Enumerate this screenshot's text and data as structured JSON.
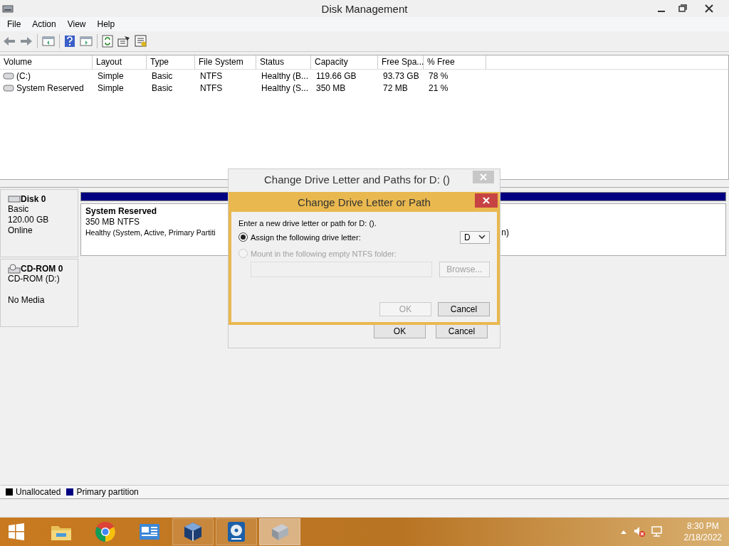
{
  "window": {
    "title": "Disk Management"
  },
  "menu": [
    "File",
    "Action",
    "View",
    "Help"
  ],
  "table": {
    "columns": [
      "Volume",
      "Layout",
      "Type",
      "File System",
      "Status",
      "Capacity",
      "Free Spa...",
      "% Free"
    ],
    "rows": [
      [
        "(C:)",
        "Simple",
        "Basic",
        "NTFS",
        "Healthy (B...",
        "119.66 GB",
        "93.73 GB",
        "78 %"
      ],
      [
        "System Reserved",
        "Simple",
        "Basic",
        "NTFS",
        "Healthy (S...",
        "350 MB",
        "72 MB",
        "21 %"
      ]
    ]
  },
  "disks": [
    {
      "kind": "disk",
      "name": "Disk 0",
      "lines": [
        "Basic",
        "120.00 GB",
        "Online"
      ],
      "partition": {
        "name": "System Reserved",
        "size": "350 MB NTFS",
        "status_start": "Healthy (System, Active, Primary Partiti",
        "status_end": "n)"
      }
    },
    {
      "kind": "cdrom",
      "name": "CD-ROM 0",
      "lines": [
        "CD-ROM (D:)",
        "No Media"
      ]
    }
  ],
  "legend": [
    {
      "label": "Unallocated",
      "color": "#000000"
    },
    {
      "label": "Primary partition",
      "color": "#000080"
    }
  ],
  "outer_dialog": {
    "title": "Change Drive Letter and Paths for D: ()",
    "buttons": [
      "OK",
      "Cancel"
    ]
  },
  "dialog": {
    "title": "Change Drive Letter or Path",
    "prompt": "Enter a new drive letter or path for D: ().",
    "options": [
      {
        "label": "Assign the following drive letter:",
        "selected": true,
        "disabled": false
      },
      {
        "label": "Mount in the following empty NTFS folder:",
        "selected": false,
        "disabled": true
      }
    ],
    "letter": "D",
    "browse": "Browse...",
    "ok": {
      "label": "OK",
      "disabled": true
    },
    "cancel": "Cancel"
  },
  "taskbar": {
    "apps": [
      {
        "kind": "explorer",
        "selected": false
      },
      {
        "kind": "chrome",
        "selected": false
      },
      {
        "kind": "panel",
        "selected": false
      },
      {
        "kind": "cube",
        "selected": false
      },
      {
        "kind": "disc",
        "selected": false
      },
      {
        "kind": "disk",
        "selected": true
      }
    ],
    "time": "8:30 PM",
    "date": "2/18/2022"
  }
}
